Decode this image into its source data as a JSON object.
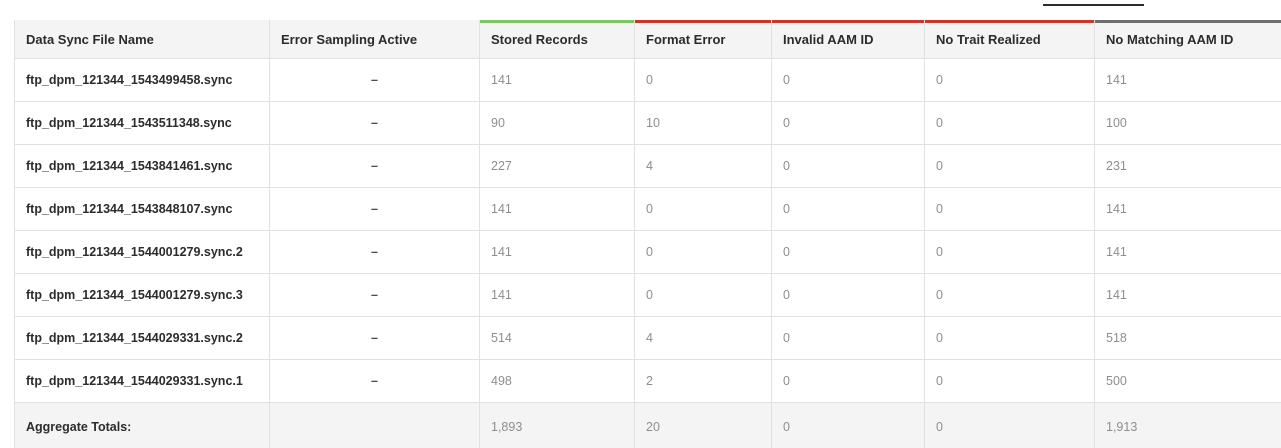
{
  "table": {
    "headers": [
      {
        "label": "Data Sync File Name",
        "accent": ""
      },
      {
        "label": "Error Sampling Active",
        "accent": ""
      },
      {
        "label": "Stored Records",
        "accent": "#7fc465"
      },
      {
        "label": "Format Error",
        "accent": "#c9372c"
      },
      {
        "label": "Invalid AAM ID",
        "accent": "#c9372c"
      },
      {
        "label": "No Trait Realized",
        "accent": "#c9372c"
      },
      {
        "label": "No Matching AAM ID",
        "accent": "#6e6e6e"
      }
    ],
    "rows": [
      {
        "file": "ftp_dpm_121344_1543499458.sync",
        "sampling": "–",
        "stored": "141",
        "format_error": "0",
        "invalid_id": "0",
        "no_trait": "0",
        "no_match": "141"
      },
      {
        "file": "ftp_dpm_121344_1543511348.sync",
        "sampling": "–",
        "stored": "90",
        "format_error": "10",
        "invalid_id": "0",
        "no_trait": "0",
        "no_match": "100"
      },
      {
        "file": "ftp_dpm_121344_1543841461.sync",
        "sampling": "–",
        "stored": "227",
        "format_error": "4",
        "invalid_id": "0",
        "no_trait": "0",
        "no_match": "231"
      },
      {
        "file": "ftp_dpm_121344_1543848107.sync",
        "sampling": "–",
        "stored": "141",
        "format_error": "0",
        "invalid_id": "0",
        "no_trait": "0",
        "no_match": "141"
      },
      {
        "file": "ftp_dpm_121344_1544001279.sync.2",
        "sampling": "–",
        "stored": "141",
        "format_error": "0",
        "invalid_id": "0",
        "no_trait": "0",
        "no_match": "141"
      },
      {
        "file": "ftp_dpm_121344_1544001279.sync.3",
        "sampling": "–",
        "stored": "141",
        "format_error": "0",
        "invalid_id": "0",
        "no_trait": "0",
        "no_match": "141"
      },
      {
        "file": "ftp_dpm_121344_1544029331.sync.2",
        "sampling": "–",
        "stored": "514",
        "format_error": "4",
        "invalid_id": "0",
        "no_trait": "0",
        "no_match": "518"
      },
      {
        "file": "ftp_dpm_121344_1544029331.sync.1",
        "sampling": "–",
        "stored": "498",
        "format_error": "2",
        "invalid_id": "0",
        "no_trait": "0",
        "no_match": "500"
      }
    ],
    "totals": {
      "label": "Aggregate Totals:",
      "sampling": "",
      "stored": "1,893",
      "format_error": "20",
      "invalid_id": "0",
      "no_trait": "0",
      "no_match": "1,913"
    }
  }
}
